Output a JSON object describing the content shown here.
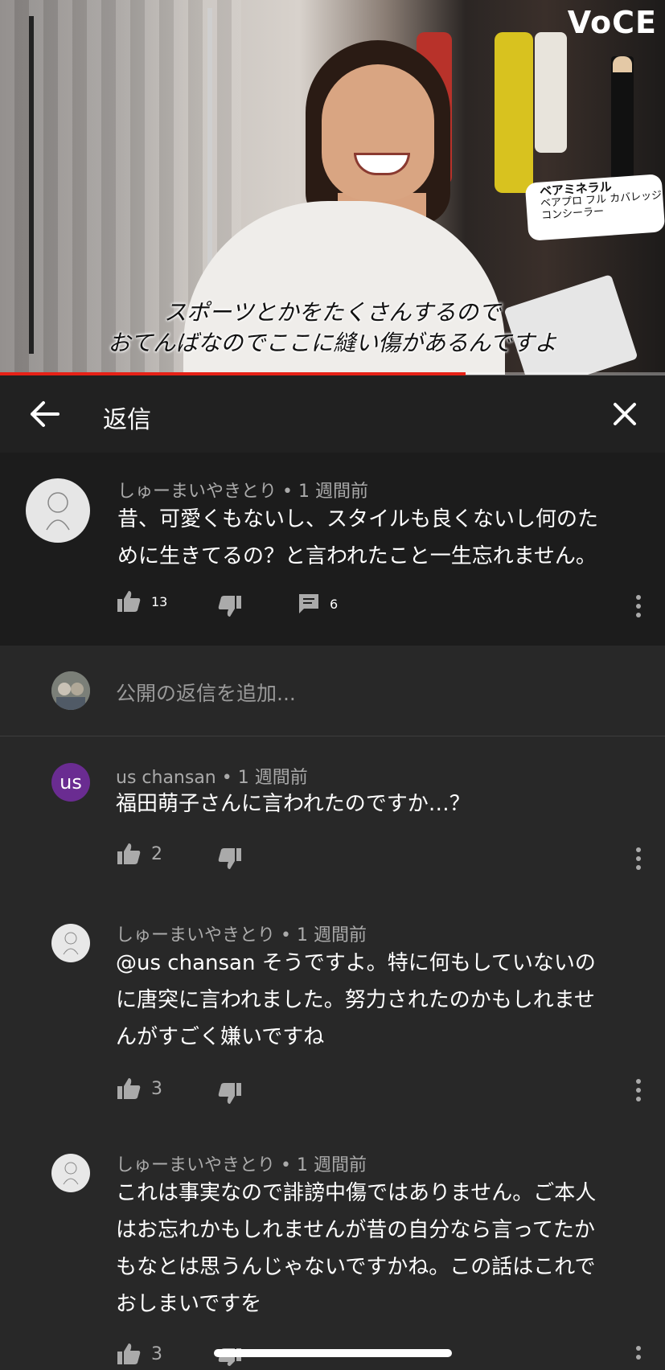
{
  "video": {
    "logo": "VoCE",
    "subtitle_line1": "スポーツとかをたくさんするので",
    "subtitle_line2": "おてんばなのでここに縫い傷があるんですよ",
    "product_brand": "ベアミネラル",
    "product_name_line1": "ベアプロ フル カバレッジ",
    "product_name_line2": "コンシーラー",
    "progress_fraction": 0.7
  },
  "header": {
    "back_icon": "arrow-left-icon",
    "title": "返信",
    "close_icon": "close-icon"
  },
  "top_comment": {
    "author": "しゅーまいやきとり",
    "time": "1 週間前",
    "text_line1": "昔、可愛くもないし、スタイルも良くないし何のた",
    "text_line2": "めに生きてるの？と言われたこと一生忘れません。",
    "likes": "13",
    "replies": "6"
  },
  "reply_input": {
    "placeholder": "公開の返信を追加..."
  },
  "replies": [
    {
      "author": "us chansan",
      "time": "1 週間前",
      "avatar_text": "us",
      "lines": [
        "福田萌子さんに言われたのですか…？"
      ],
      "likes": "2"
    },
    {
      "author": "しゅーまいやきとり",
      "time": "1 週間前",
      "lines": [
        "@us chansan  そうですよ。特に何もしていないの",
        "に唐突に言われました。努力されたのかもしれませ",
        "んがすごく嫌いですね"
      ],
      "likes": "3"
    },
    {
      "author": "しゅーまいやきとり",
      "time": "1 週間前",
      "lines": [
        "これは事実なので誹謗中傷ではありません。ご本人",
        "はお忘れかもしれませんが昔の自分なら言ってたか",
        "もなとは思うんじゃないですかね。この話はこれで",
        "おしまいですを"
      ],
      "likes": "3"
    }
  ],
  "colors": {
    "background": "#282828",
    "header": "#212121",
    "top_comment_bg": "#1c1c1c",
    "progress_red": "#e62117",
    "meta_gray": "#aaaaaa"
  }
}
